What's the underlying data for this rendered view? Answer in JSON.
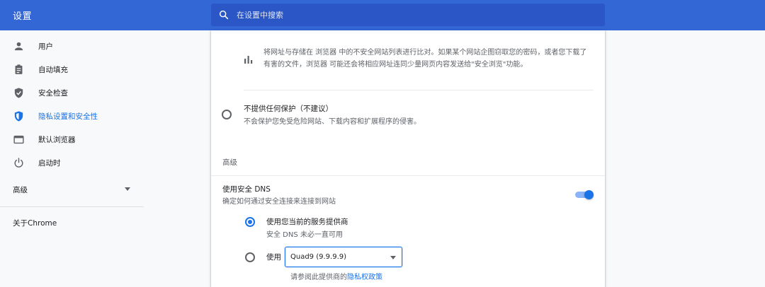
{
  "header": {
    "title": "设置"
  },
  "search": {
    "placeholder": "在设置中搜索"
  },
  "sidebar": {
    "items": [
      {
        "label": "用户",
        "icon": "person-icon"
      },
      {
        "label": "自动填充",
        "icon": "clipboard-icon"
      },
      {
        "label": "安全检查",
        "icon": "shield-check-icon"
      },
      {
        "label": "隐私设置和安全性",
        "icon": "shield-icon",
        "active": true
      },
      {
        "label": "默认浏览器",
        "icon": "browser-icon"
      },
      {
        "label": "启动时",
        "icon": "power-icon"
      }
    ],
    "advanced": "高级",
    "about": "关于Chrome"
  },
  "main": {
    "enhanced_description": "将网址与存储在 浏览器 中的不安全网站列表进行比对。如果某个网站企图窃取您的密码，或者您下载了有害的文件，浏览器 可能还会将相应网址连同少量网页内容发送给\"安全浏览\"功能。",
    "no_protection": {
      "title": "不提供任何保护（不建议）",
      "subtitle": "不会保护您免受危险网站、下载内容和扩展程序的侵害。"
    },
    "advanced_heading": "高级",
    "secure_dns": {
      "title": "使用安全 DNS",
      "subtitle": "确定如何通过安全连接来连接到网站",
      "enabled": true,
      "current_provider": {
        "title": "使用您当前的服务提供商",
        "subtitle": "安全 DNS 未必一直可用"
      },
      "custom": {
        "label": "使用",
        "selected": "Quad9 (9.9.9.9)"
      },
      "privacy_prefix": "请参阅此提供商的",
      "privacy_link": "隐私权政策"
    }
  },
  "colors": {
    "accent": "#1a73e8",
    "header": "#3367d6",
    "search": "#2a56c6"
  }
}
